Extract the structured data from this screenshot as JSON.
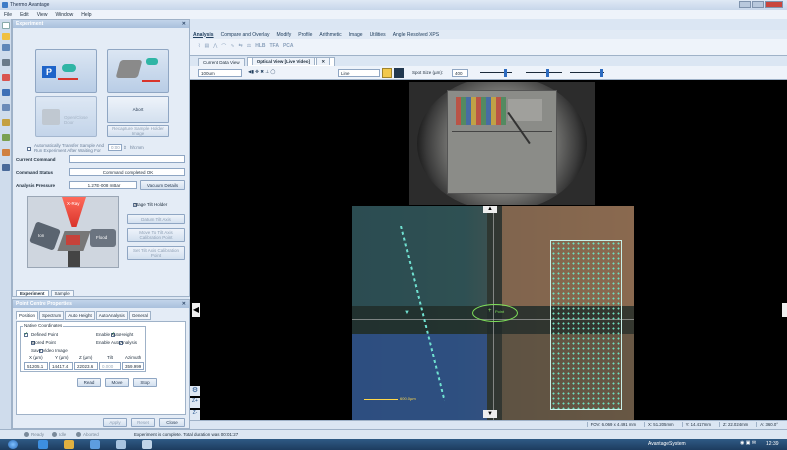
{
  "window": {
    "title": "Thermo Avantage"
  },
  "menu": [
    "File",
    "Edit",
    "View",
    "Window",
    "Help"
  ],
  "experiment_panel": {
    "title": "Experiment",
    "open_close_door": "Open/Close Door",
    "abort": "Abort",
    "recapture": "Recapture Sample Holder Image",
    "auto_transfer": "Automatically Transfer Sample And Run Experiment After Waiting For",
    "wait_value": "0:00",
    "wait_unit": "hh:mm",
    "current_command_label": "Current Command",
    "current_command_value": "",
    "command_status_label": "Command Status",
    "command_status_value": "Command completed OK",
    "analysis_pressure_label": "Analysis Pressure",
    "analysis_pressure_value": "1.27E-008 mBar",
    "vacuum_details": "Vacuum Details",
    "xray_label": "X-Ray",
    "ion_label": "Ion",
    "flood_label": "Flood",
    "stage_tilt_holder": "Stage Tilt Holder",
    "datum_tilt_axis": "Datum Tilt Axis",
    "move_tilt_calib": "Move To Tilt Axis Calibration Point",
    "set_tilt_calib": "Set Tilt Axis Calibration Point",
    "tab_experiment": "Experiment",
    "tab_sample": "Sample"
  },
  "pcp": {
    "title": "Point Centre Properties",
    "tabs": [
      "Position",
      "Spectrum",
      "Auto Height",
      "AutoAnalysis",
      "General"
    ],
    "group_title": "Native Coordinates",
    "defined_point": "Defined Point",
    "stored_point": "Stored Point",
    "save_video_image": "Save Video Image",
    "enable_auto_height": "Enable AutoHeight",
    "enable_auto_analysis": "Enable AutoAnalysis",
    "coord_headers": [
      "X (µm)",
      "Y (µm)",
      "Z (µm)",
      "Tilt",
      "Azimuth"
    ],
    "coord_values": [
      "51205.1",
      "14417.4",
      "22023.6",
      "0.000",
      "359.999"
    ],
    "read": "Read",
    "move": "Move",
    "stop": "Stop",
    "apply": "Apply",
    "reset": "Reset",
    "close": "Close"
  },
  "ribbon": {
    "tabs": [
      "Analysis",
      "Compare and Overlay",
      "Modify",
      "Profile",
      "Arithmetic",
      "Image",
      "Utilities",
      "Angle Resolved XPS"
    ],
    "icons": [
      "HLB",
      "TFA",
      "PCA"
    ]
  },
  "doc_tabs": [
    "Current Data View",
    "Optical View [Live Video]"
  ],
  "view_toolbar": {
    "scale": "100um",
    "mode": "Line",
    "spot_size_label": "Spot Size (µm):",
    "spot_size_value": "400"
  },
  "main_cam": {
    "point_label": "Point",
    "scale_label": "600.0µm"
  },
  "status_strip": {
    "fov": "FOV: 6.069 x 4.491 mm",
    "x": "X: 51.205mm",
    "y": "Y: 14.417mm",
    "z": "Z: 22.024mm",
    "a": "A: 360.0°"
  },
  "bottom_status": {
    "message": "Experiment is complete. Total duration was 00:01:27",
    "lights": [
      "Ready",
      "Idle",
      "Aborted"
    ]
  },
  "taskbar": {
    "system_name": "AvantageSystem",
    "time": "12:39"
  },
  "colors": {
    "accent": "#1d4e89",
    "ribbon_bg": "#eef3fa",
    "video_bg": "#000000"
  }
}
